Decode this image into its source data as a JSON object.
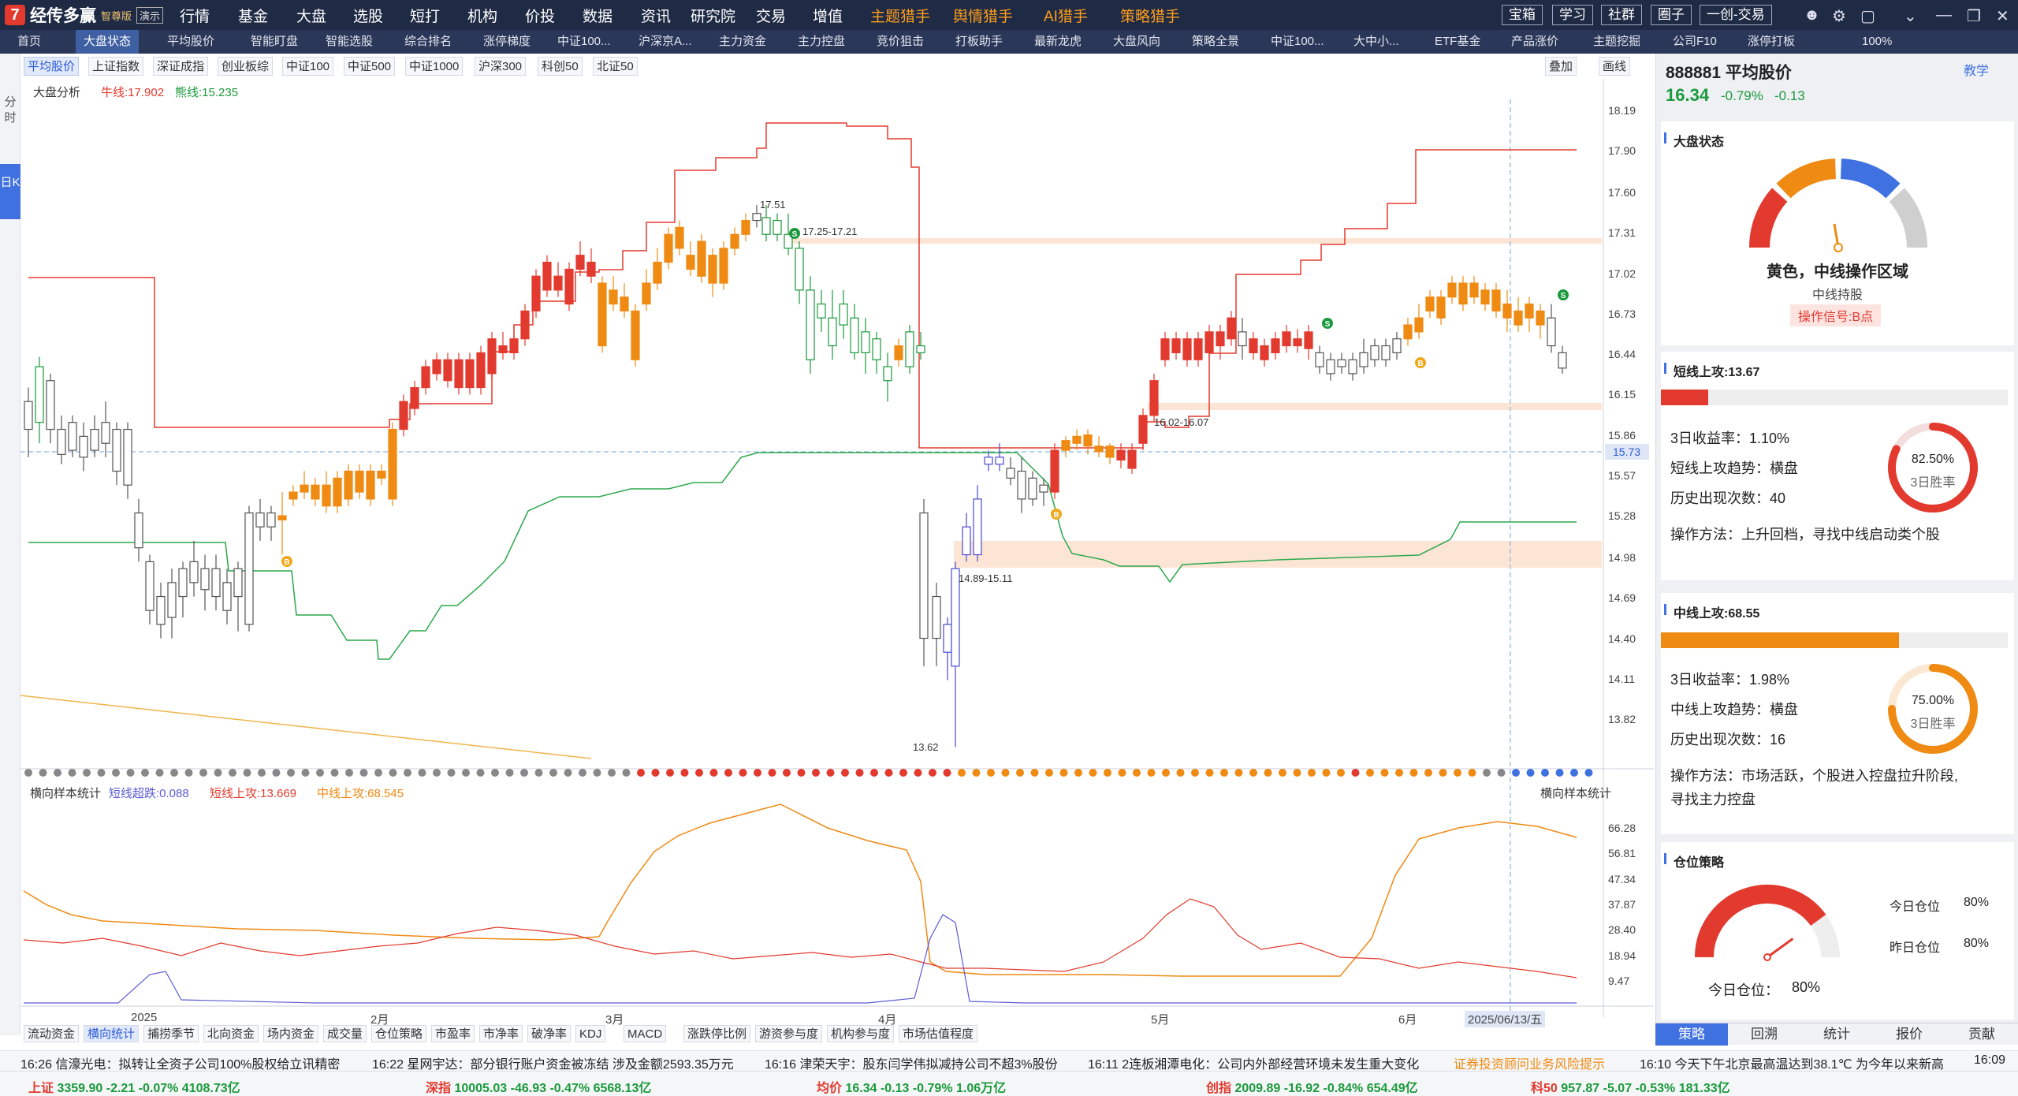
{
  "app": {
    "name": "经传多赢",
    "edition": "智尊版",
    "mode": "演示",
    "menus": [
      "行情",
      "基金",
      "大盘",
      "选股",
      "短打",
      "机构",
      "价投",
      "数据",
      "资讯",
      "研究院",
      "交易",
      "增值"
    ],
    "hunter_menus": [
      "主题猎手",
      "舆情猎手",
      "AI猎手",
      "策略猎手"
    ],
    "right_buttons": [
      "宝箱",
      "学习",
      "社群",
      "圈子",
      "一创-交易"
    ]
  },
  "tabs": [
    "首页",
    "大盘状态",
    "平均股价",
    "智能盯盘",
    "智能选股",
    "综合排名",
    "涨停梯度",
    "中证100...",
    "沪深京A...",
    "主力资金",
    "主力控盘",
    "竞价狙击",
    "打板助手",
    "最新龙虎",
    "大盘风向",
    "策略全景",
    "中证100...",
    "大中小...",
    "ETF基金",
    "产品涨价",
    "主题挖掘",
    "公司F10",
    "涨停打板"
  ],
  "zoom": "100%",
  "rail": {
    "top": "分时",
    "active": "日K"
  },
  "index_tabs": [
    "平均股价",
    "上证指数",
    "深证成指",
    "创业板综",
    "中证100",
    "中证500",
    "中证1000",
    "沪深300",
    "科创50",
    "北证50"
  ],
  "overlay_buttons": [
    "叠加",
    "画线"
  ],
  "chart_legend": {
    "name": "大盘分析",
    "upper_label": "牛线:17.902",
    "lower_label": "熊线:15.235"
  },
  "indicator_legend": {
    "name": "横向样本统计",
    "short_extreme": "短线超跌:0.088",
    "short_up": "短线上攻:13.669",
    "mid_up": "中线上攻:68.545",
    "right_name": "横向样本统计"
  },
  "price_axis": [
    "18.19",
    "17.90",
    "17.60",
    "17.31",
    "17.02",
    "16.73",
    "16.44",
    "16.15",
    "15.86",
    "15.57",
    "15.28",
    "14.98",
    "14.69",
    "14.40",
    "14.11",
    "13.82"
  ],
  "current_price_tag": "15.73",
  "indicator_axis": [
    "66.28",
    "56.81",
    "47.34",
    "37.87",
    "28.40",
    "18.94",
    "9.47"
  ],
  "x_axis": [
    "2025",
    "2月",
    "3月",
    "4月",
    "5月",
    "6月",
    "2025/06/13/五"
  ],
  "annotations": {
    "high": "17.51",
    "zone_top": "17.25-17.21",
    "zone_mid": "16.02-16.07",
    "zone_low": "14.89-15.11",
    "low": "13.62"
  },
  "bottom_tabs": [
    "流动资金",
    "横向统计",
    "捕捞季节",
    "北向资金",
    "场内资金",
    "成交量",
    "仓位策略",
    "市盈率",
    "市净率",
    "破净率",
    "KDJ",
    "MACD",
    "涨跌停比例",
    "游资参与度",
    "机构参与度",
    "市场估值程度"
  ],
  "panel": {
    "code_name": "888881 平均股价",
    "price": "16.34",
    "change_pct": "-0.79%",
    "change": "-0.13",
    "help": "教学",
    "market_state": {
      "title": "大盘状态",
      "state": "黄色，中线操作区域",
      "advice": "中线持股",
      "signal": "操作信号:B点"
    },
    "short": {
      "title": "短线上攻:13.67",
      "level": 0.1367,
      "ret3": "3日收益率：1.10%",
      "trend": "短线上攻趋势：横盘",
      "count": "历史出现次数：40",
      "method": "操作方法：上升回档，寻找中线启动类个股",
      "win": "82.50%",
      "win_label": "3日胜率"
    },
    "mid": {
      "title": "中线上攻:68.55",
      "level": 0.6855,
      "ret3": "3日收益率：1.98%",
      "trend": "中线上攻趋势：横盘",
      "count": "历史出现次数：16",
      "method1": "操作方法：市场活跃，个股进入控盘拉升阶段,",
      "method2": "寻找主力控盘",
      "win": "75.00%",
      "win_label": "3日胜率"
    },
    "position": {
      "title": "仓位策略",
      "today_label": "今日仓位：",
      "today_value": "80%",
      "today_pos": "今日仓位",
      "today_pos_val": "80%",
      "yesterday_pos": "昨日仓位",
      "yesterday_pos_val": "80%"
    },
    "tabs": [
      "策略",
      "回溯",
      "统计",
      "报价",
      "贡献"
    ]
  },
  "news": [
    "16:26 信濠光电：拟转让全资子公司100%股权给立讯精密",
    "16:22 星网宇达：部分银行账户资金被冻结 涉及金额2593.35万元",
    "16:16 津荣天宇：股东闫学伟拟减持公司不超3%股份",
    "16:11 2连板湘潭电化：公司内外部经营环境未发生重大变化",
    "证券投资顾问业务风险提示",
    "16:10 今天下午北京最高温达到38.1℃ 为今年以来新高",
    "16:09"
  ],
  "status_bar": [
    {
      "name": "上证",
      "price": "3359.90",
      "chg": "-2.21",
      "pct": "-0.07%",
      "amt": "4108.73亿"
    },
    {
      "name": "深指",
      "price": "10005.03",
      "chg": "-46.93",
      "pct": "-0.47%",
      "amt": "6568.13亿"
    },
    {
      "name": "均价",
      "price": "16.34",
      "chg": "-0.13",
      "pct": "-0.79%",
      "amt": "1.06万亿"
    },
    {
      "name": "创指",
      "price": "2009.89",
      "chg": "-16.92",
      "pct": "-0.84%",
      "amt": "654.49亿"
    },
    {
      "name": "科50",
      "price": "957.87",
      "chg": "-5.07",
      "pct": "-0.53%",
      "amt": "181.33亿"
    }
  ],
  "colors": {
    "up": "#e23a2e",
    "down": "#1a9a3c",
    "orange": "#ef8a12",
    "blue": "#3f71e0",
    "bull_line": "#e23a2e",
    "bear_line": "#2aa84a"
  },
  "icons": [
    "user-icon",
    "gear-icon",
    "window-icon",
    "chevron-down-icon",
    "minimize-icon",
    "maximize-icon",
    "close-icon"
  ]
}
